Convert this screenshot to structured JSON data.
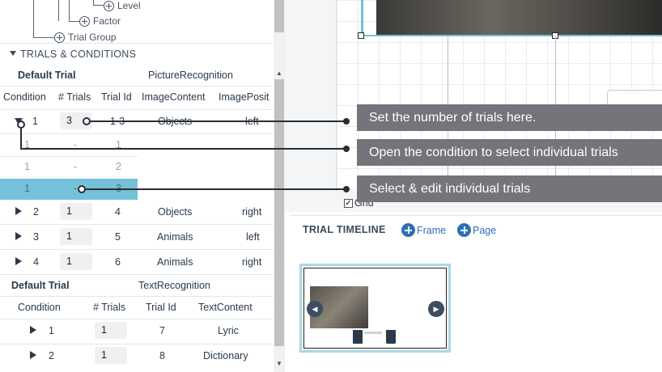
{
  "tree": {
    "level": "Level",
    "factor": "Factor",
    "trial_group": "Trial Group"
  },
  "section": {
    "title": "TRIALS & CONDITIONS"
  },
  "table1": {
    "name": "Default Trial",
    "task": "PictureRecognition",
    "headers": [
      "Condition",
      "# Trials",
      "Trial Id",
      "ImageContent",
      "ImagePosit"
    ],
    "rows": [
      {
        "condition": "1",
        "trials": "3",
        "trial_id": "1-3",
        "content": "Objects",
        "position": "left"
      },
      {
        "condition": "1",
        "trials": "-",
        "trial_id": "1"
      },
      {
        "condition": "1",
        "trials": "-",
        "trial_id": "2"
      },
      {
        "condition": "1",
        "trials": "-",
        "trial_id": "3"
      },
      {
        "condition": "2",
        "trials": "1",
        "trial_id": "4",
        "content": "Objects",
        "position": "right"
      },
      {
        "condition": "3",
        "trials": "1",
        "trial_id": "5",
        "content": "Animals",
        "position": "left"
      },
      {
        "condition": "4",
        "trials": "1",
        "trial_id": "6",
        "content": "Animals",
        "position": "right"
      }
    ]
  },
  "table2": {
    "name": "Default Trial",
    "task": "TextRecognition",
    "headers": [
      "Condition",
      "# Trials",
      "Trial Id",
      "TextContent"
    ],
    "rows": [
      {
        "condition": "1",
        "trials": "1",
        "trial_id": "7",
        "content": "Lyric"
      },
      {
        "condition": "2",
        "trials": "1",
        "trial_id": "8",
        "content": "Dictionary"
      }
    ]
  },
  "canvas": {
    "grid_label": "Grid"
  },
  "timeline": {
    "title": "TRIAL TIMELINE",
    "add_frame": "Frame",
    "add_page": "Page"
  },
  "tooltips": [
    "Set the number of trials here.",
    "Open the condition to select individual trials",
    "Select & edit individual trials"
  ],
  "colors": {
    "selected_row": "#74c1d9",
    "tooltip_bg": "#74757a",
    "accent": "#2d6fb3"
  }
}
